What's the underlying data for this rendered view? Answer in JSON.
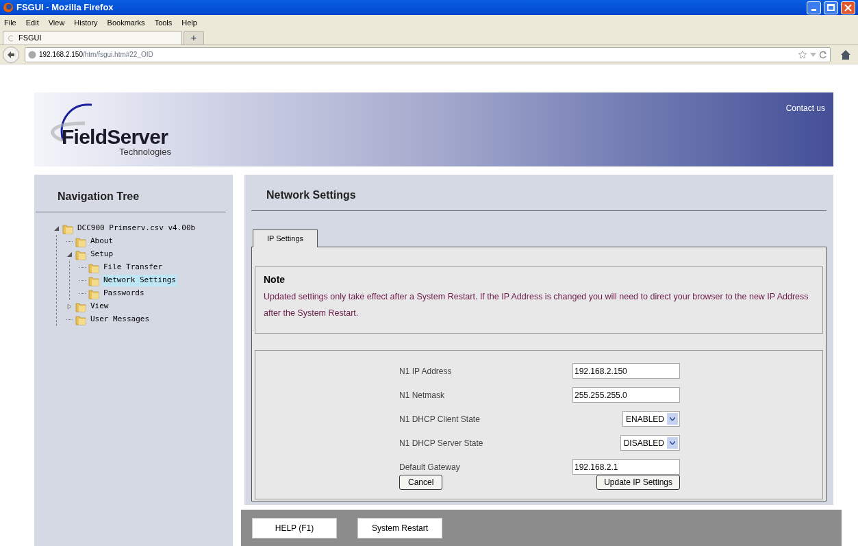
{
  "window": {
    "title": "FSGUI - Mozilla Firefox"
  },
  "menu": [
    "File",
    "Edit",
    "View",
    "History",
    "Bookmarks",
    "Tools",
    "Help"
  ],
  "browser_tab": {
    "title": "FSGUI",
    "new_tab": "+"
  },
  "address": {
    "host": "192.168.2.150",
    "path": "/htm/fsgui.htm#22_OID"
  },
  "header": {
    "logo": "FieldServer",
    "logo_sub": "Technologies",
    "contact": "Contact us"
  },
  "sidebar": {
    "title": "Navigation Tree",
    "tree": [
      {
        "label": "DCC900 Primserv.csv v4.00b",
        "selected": false,
        "expanded": true,
        "children": [
          {
            "label": "About",
            "selected": false
          },
          {
            "label": "Setup",
            "selected": false,
            "expanded": true,
            "children": [
              {
                "label": "File Transfer",
                "selected": false
              },
              {
                "label": "Network Settings",
                "selected": true
              },
              {
                "label": "Passwords",
                "selected": false
              }
            ]
          },
          {
            "label": "View",
            "selected": false,
            "expanded": false
          },
          {
            "label": "User Messages",
            "selected": false
          }
        ]
      }
    ]
  },
  "main": {
    "title": "Network Settings",
    "tabs": [
      {
        "label": "IP Settings",
        "selected": true
      }
    ],
    "note": {
      "title": "Note",
      "text": "Updated settings only take effect after a System Restart. If the IP Address is changed you will need to direct your browser to the new IP Address after the System Restart."
    },
    "fields": [
      {
        "kind": "input",
        "label": "N1 IP Address",
        "value": "192.168.2.150"
      },
      {
        "kind": "input",
        "label": "N1 Netmask",
        "value": "255.255.255.0"
      },
      {
        "kind": "select",
        "label": "N1 DHCP Client State",
        "value": "ENABLED"
      },
      {
        "kind": "select",
        "label": "N1 DHCP Server State",
        "value": "DISABLED"
      },
      {
        "kind": "input",
        "label": "Default Gateway",
        "value": "192.168.2.1"
      }
    ],
    "cancel": "Cancel",
    "update": "Update IP Settings"
  },
  "footer": {
    "buttons": [
      "HELP (F1)",
      "System Restart"
    ]
  }
}
